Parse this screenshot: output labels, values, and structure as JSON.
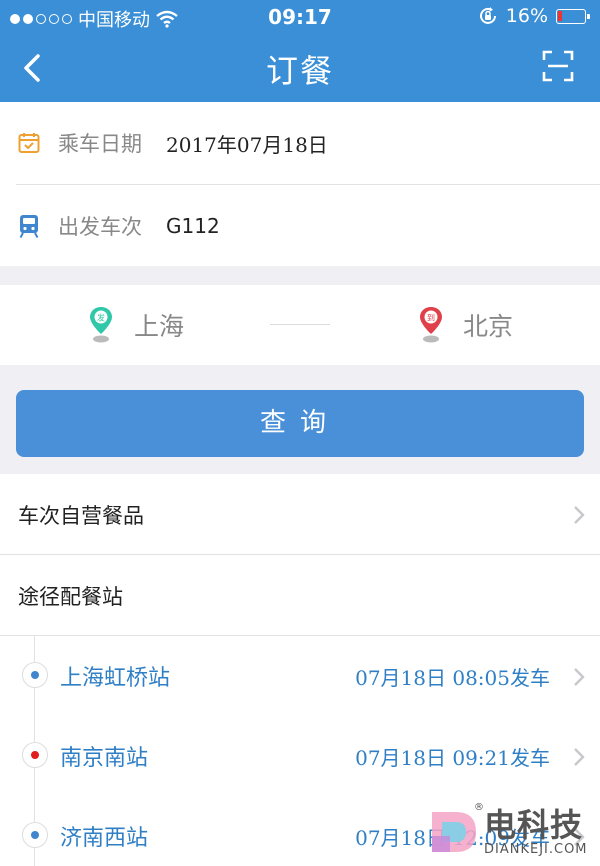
{
  "status_bar": {
    "carrier": "中国移动",
    "time": "09:17",
    "battery": "16%",
    "battery_level": 0.16
  },
  "nav": {
    "title": "订餐"
  },
  "form": {
    "date_label": "乘车日期",
    "date_value": "2017年07月18日",
    "train_label": "出发车次",
    "train_value": "G112"
  },
  "route": {
    "from": "上海",
    "to": "北京",
    "from_tag": "发",
    "to_tag": "到"
  },
  "query_button": "查询",
  "menu": {
    "self_meal": "车次自营餐品",
    "stations_title": "途径配餐站"
  },
  "stations": [
    {
      "name": "上海虹桥站",
      "time": "07月18日 08:05发车",
      "color": "#3f86cf"
    },
    {
      "name": "南京南站",
      "time": "07月18日 09:21发车",
      "color": "#e11d1d"
    },
    {
      "name": "济南西站",
      "time": "07月18日 12:09发车",
      "color": "#3f86cf"
    }
  ],
  "watermark": {
    "text": "电科技",
    "sub": "DIANKEJI.COM",
    "reg": "®"
  },
  "colors": {
    "header": "#3a8fd6",
    "button": "#4a90d9",
    "station_text": "#2f7fc6",
    "from_pin": "#2fc8a8",
    "to_pin": "#e0404a"
  }
}
